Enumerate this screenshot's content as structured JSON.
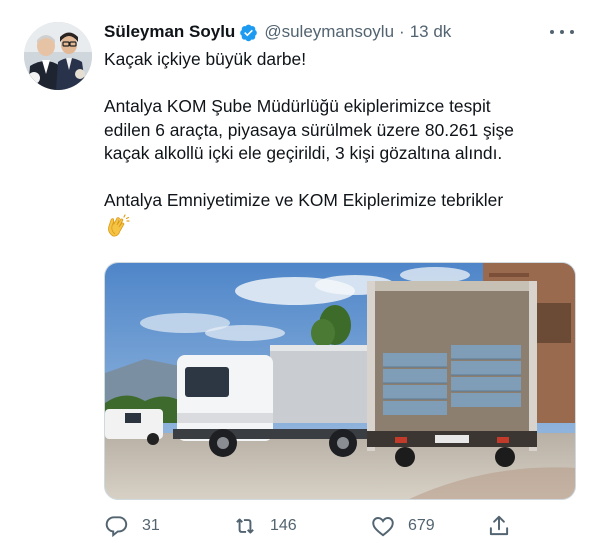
{
  "author": {
    "name": "Süleyman Soylu",
    "handle": "@suleymansoylu",
    "separator": "·",
    "time": "13 dk"
  },
  "tweet": {
    "line1": "Kaçak içkiye büyük darbe!",
    "para2_line1": "Antalya KOM Şube Müdürlüğü ekiplerimizce tespit",
    "para2_line2": "edilen 6 araçta, piyasaya sürülmek üzere 80.261 şişe",
    "para2_line3": "kaçak alkollü içki ele geçirildi, 3 kişi gözaltına alındı.",
    "para3_line1": "Antalya Emniyetimize ve KOM Ekiplerimize tebrikler",
    "emoji": "clapping-hands"
  },
  "stats": {
    "replies": "31",
    "retweets": "146",
    "likes": "679"
  },
  "icons": {
    "verified": "verified-badge-icon",
    "more": "more-icon",
    "reply": "reply-icon",
    "retweet": "retweet-icon",
    "like": "like-icon",
    "share": "share-icon"
  },
  "colors": {
    "verified": "#1d9bf0",
    "text": "#0f1419",
    "secondary": "#536471"
  }
}
